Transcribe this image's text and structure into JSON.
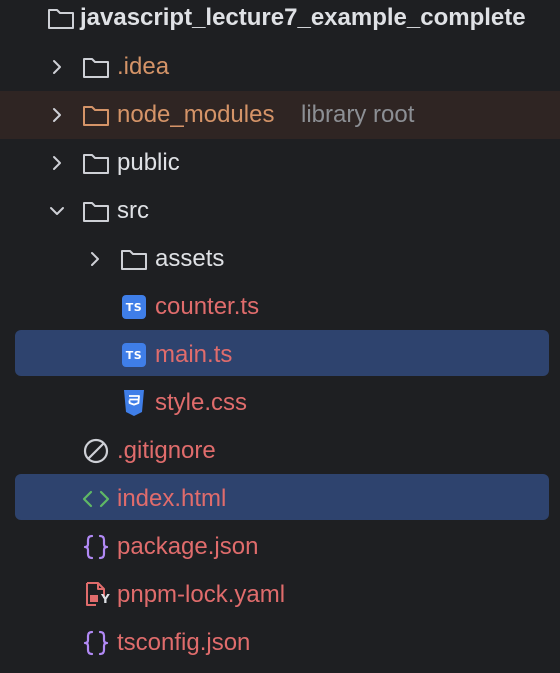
{
  "project": {
    "name": "javascript_lecture7_example_complete"
  },
  "items": [
    {
      "label": ".idea",
      "icon": "folder-icon",
      "type": "folder",
      "expanded": false
    },
    {
      "label": "node_modules",
      "hint": "library root",
      "icon": "folder-icon",
      "type": "folder",
      "expanded": false
    },
    {
      "label": "public",
      "icon": "folder-icon",
      "type": "folder",
      "expanded": false
    },
    {
      "label": "src",
      "icon": "folder-icon",
      "type": "folder",
      "expanded": true
    },
    {
      "label": "assets",
      "icon": "folder-icon",
      "type": "folder",
      "expanded": false
    },
    {
      "label": "counter.ts",
      "icon": "typescript-file-icon",
      "type": "file"
    },
    {
      "label": "main.ts",
      "icon": "typescript-file-icon",
      "type": "file",
      "selected": true
    },
    {
      "label": "style.css",
      "icon": "css-file-icon",
      "type": "file"
    },
    {
      "label": ".gitignore",
      "icon": "ignore-file-icon",
      "type": "file"
    },
    {
      "label": "index.html",
      "icon": "html-file-icon",
      "type": "file",
      "selected": true
    },
    {
      "label": "package.json",
      "icon": "json-file-icon",
      "type": "file"
    },
    {
      "label": "pnpm-lock.yaml",
      "icon": "yaml-file-icon",
      "type": "file"
    },
    {
      "label": "tsconfig.json",
      "icon": "json-file-icon",
      "type": "file"
    }
  ],
  "icons": {
    "ts_badge_text": "TS",
    "yaml_badge_text": "Y"
  },
  "colors": {
    "background": "#1e1f22",
    "selection": "#2e436e",
    "library_row": "#2f2523",
    "excluded_folder": "#d59468",
    "modified_file": "#e06c6c",
    "default_text": "#dfe1e5",
    "hint_text": "#8c8f94",
    "folder_icon": "#ced0d6",
    "typescript": "#3f7ee8",
    "css": "#3f7ee8",
    "json": "#b189f5",
    "html": "#5fb865",
    "yaml": "#e06c6c"
  }
}
